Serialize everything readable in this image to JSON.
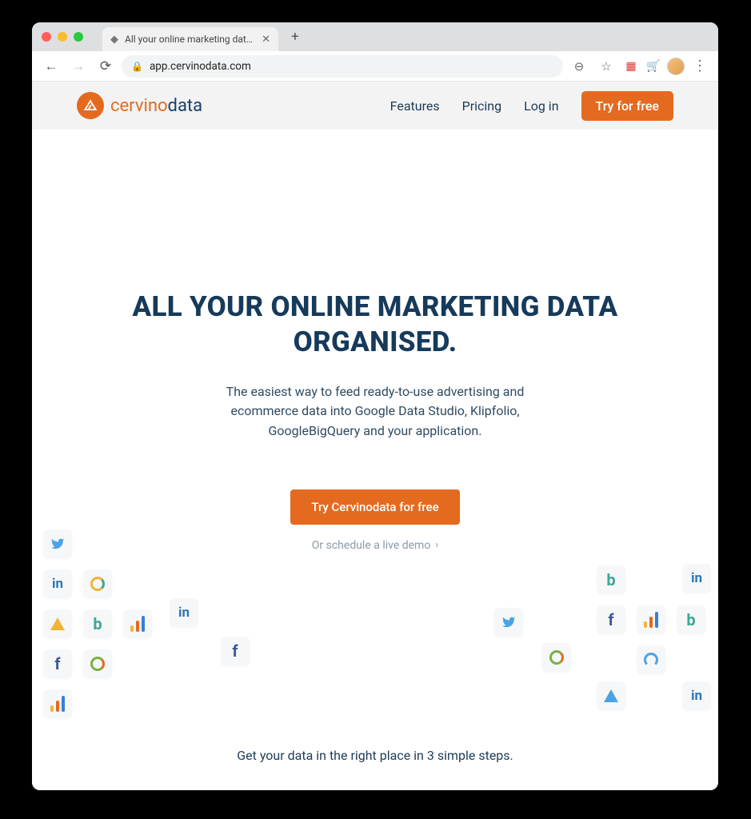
{
  "browser": {
    "tab_title": "All your online marketing data or",
    "url": "app.cervinodata.com"
  },
  "header": {
    "logo_a": "cervino",
    "logo_b": "data",
    "nav": {
      "features": "Features",
      "pricing": "Pricing",
      "login": "Log in",
      "cta": "Try for free"
    }
  },
  "hero": {
    "headline": "ALL YOUR ONLINE MARKETING DATA ORGANISED.",
    "sub": "The easiest way to feed ready-to-use advertising and ecommerce data into Google Data Studio, Klipfolio, GoogleBigQuery and your application.",
    "primary_cta": "Try Cervinodata for free",
    "secondary_cta": "Or schedule a live demo"
  },
  "footer_line": "Get your data in the right place in 3 simple steps."
}
